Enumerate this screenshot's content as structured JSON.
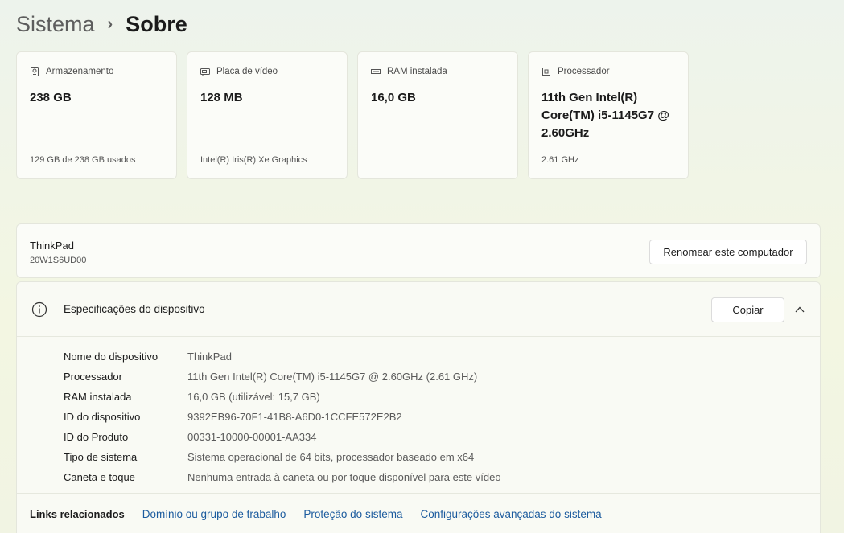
{
  "breadcrumb": {
    "parent": "Sistema",
    "separator": "›",
    "current": "Sobre"
  },
  "cards": [
    {
      "icon": "storage-icon",
      "title": "Armazenamento",
      "value": "238 GB",
      "sub": "129 GB de 238 GB usados"
    },
    {
      "icon": "gpu-icon",
      "title": "Placa de vídeo",
      "value": "128 MB",
      "sub": "Intel(R) Iris(R) Xe Graphics"
    },
    {
      "icon": "ram-icon",
      "title": "RAM instalada",
      "value": "16,0 GB",
      "sub": ""
    },
    {
      "icon": "cpu-icon",
      "title": "Processador",
      "value": "11th Gen Intel(R) Core(TM) i5-1145G7 @ 2.60GHz",
      "sub": "2.61 GHz"
    }
  ],
  "device": {
    "name": "ThinkPad",
    "model": "20W1S6UD00",
    "rename_label": "Renomear este computador"
  },
  "specs": {
    "title": "Especificações do dispositivo",
    "copy_label": "Copiar",
    "rows": [
      {
        "label": "Nome do dispositivo",
        "value": "ThinkPad"
      },
      {
        "label": "Processador",
        "value": "11th Gen Intel(R) Core(TM) i5-1145G7 @ 2.60GHz (2.61 GHz)"
      },
      {
        "label": "RAM instalada",
        "value": "16,0 GB (utilizável: 15,7 GB)"
      },
      {
        "label": "ID do dispositivo",
        "value": "9392EB96-70F1-41B8-A6D0-1CCFE572E2B2"
      },
      {
        "label": "ID do Produto",
        "value": "00331-10000-00001-AA334"
      },
      {
        "label": "Tipo de sistema",
        "value": "Sistema operacional de 64 bits, processador baseado em x64"
      },
      {
        "label": "Caneta e toque",
        "value": "Nenhuma entrada à caneta ou por toque disponível para este vídeo"
      }
    ]
  },
  "related": {
    "label": "Links relacionados",
    "links": [
      "Domínio ou grupo de trabalho",
      "Proteção do sistema",
      "Configurações avançadas do sistema"
    ]
  },
  "colors": {
    "link": "#1c5b9e",
    "accent_bg": "#f3f6e2"
  }
}
